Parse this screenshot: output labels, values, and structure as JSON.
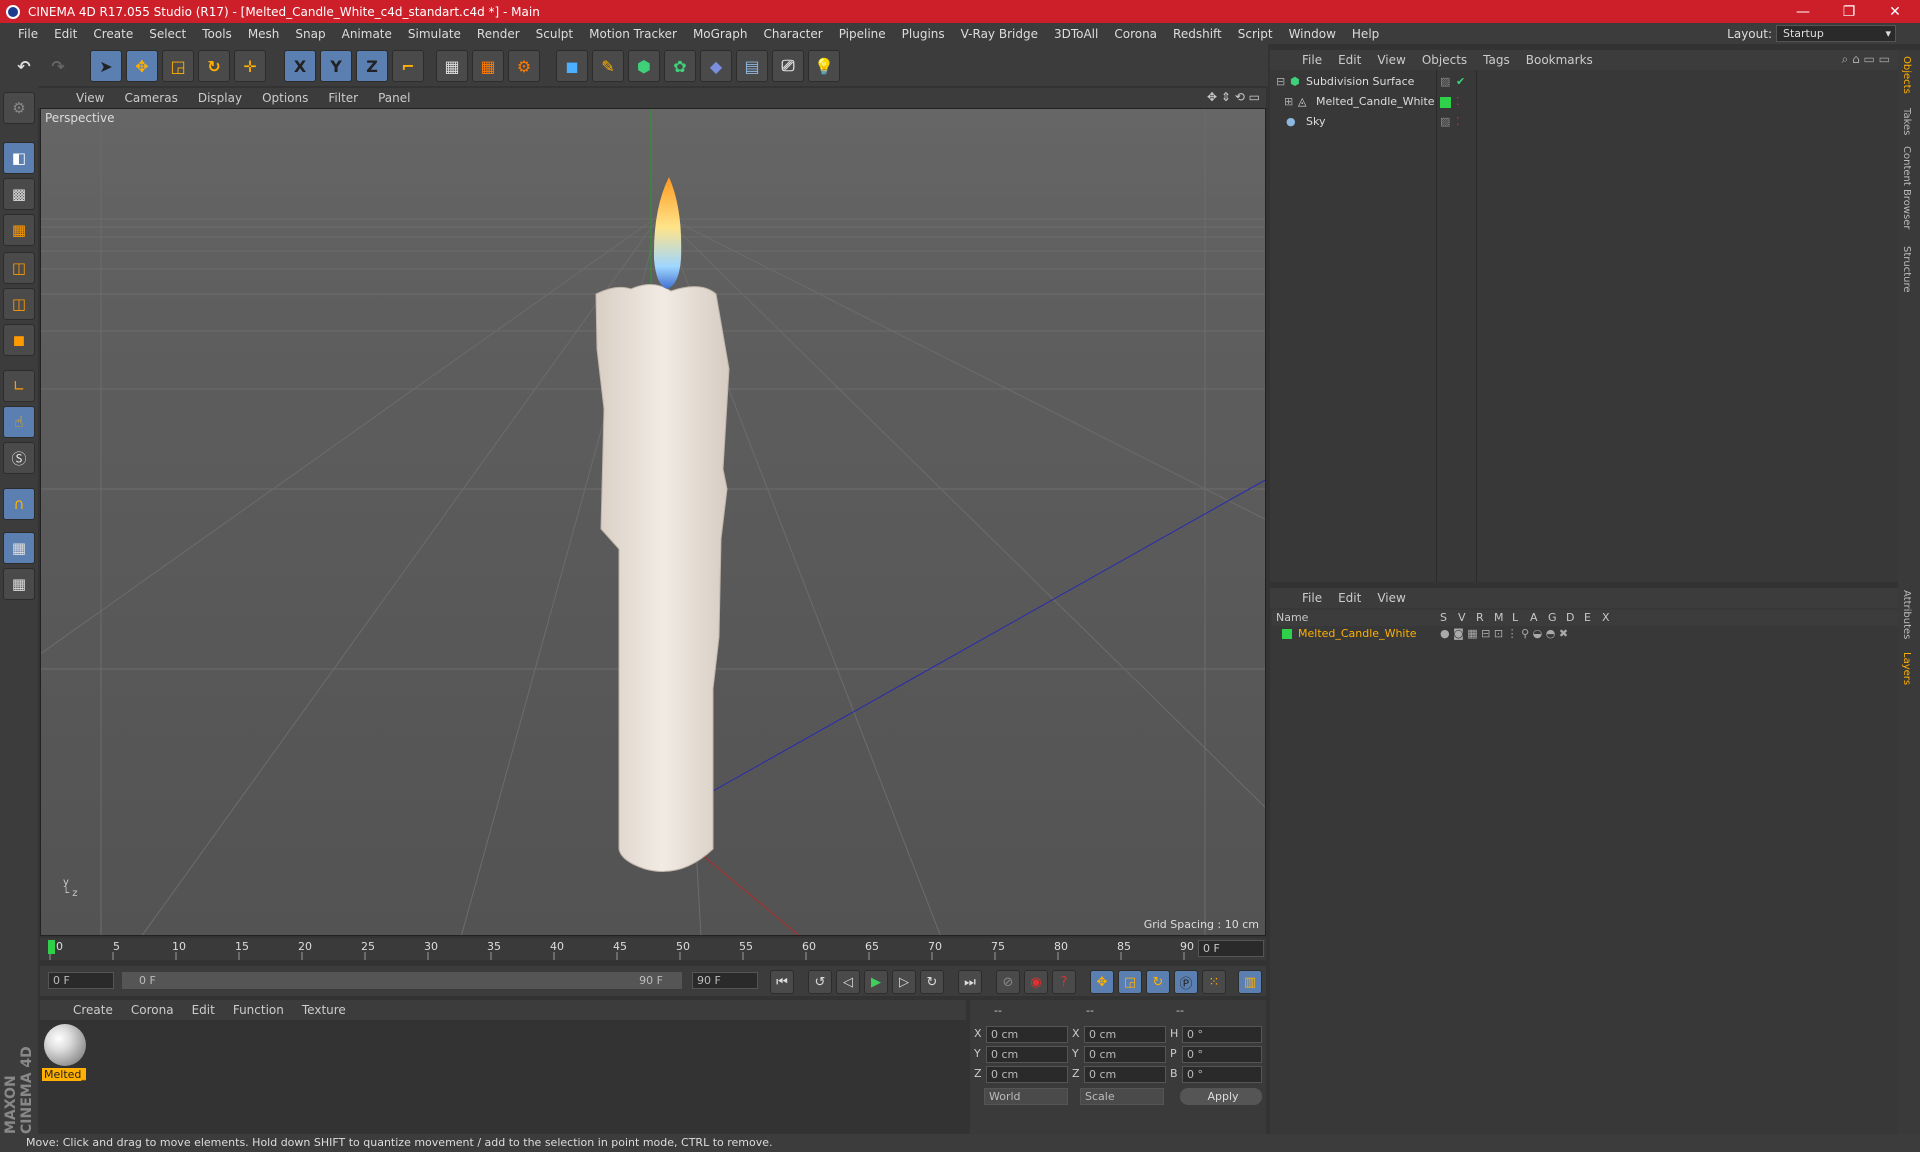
{
  "window": {
    "title": "CINEMA 4D R17.055 Studio (R17) - [Melted_Candle_White_c4d_standart.c4d *] - Main",
    "minimize": "—",
    "restore": "❐",
    "close": "✕"
  },
  "menu": [
    "File",
    "Edit",
    "Create",
    "Select",
    "Tools",
    "Mesh",
    "Snap",
    "Animate",
    "Simulate",
    "Render",
    "Sculpt",
    "Motion Tracker",
    "MoGraph",
    "Character",
    "Pipeline",
    "Plugins",
    "V-Ray Bridge",
    "3DToAll",
    "Corona",
    "Redshift",
    "Script",
    "Window",
    "Help"
  ],
  "layout": {
    "label": "Layout:",
    "value": "Startup"
  },
  "toolbar": {
    "x": "X",
    "y": "Y",
    "z": "Z"
  },
  "viewport": {
    "menu": [
      "View",
      "Cameras",
      "Display",
      "Options",
      "Filter",
      "Panel"
    ],
    "label": "Perspective",
    "grid_spacing": "Grid Spacing : 10 cm"
  },
  "timeline": {
    "ticks": [
      "0",
      "5",
      "10",
      "15",
      "20",
      "25",
      "30",
      "35",
      "40",
      "45",
      "50",
      "55",
      "60",
      "65",
      "70",
      "75",
      "80",
      "85",
      "90"
    ],
    "current_frame": "0 F",
    "start": "0 F",
    "range_start": "0 F",
    "range_end": "90 F",
    "end": "90 F"
  },
  "material_menu": [
    "Create",
    "Corona",
    "Edit",
    "Function",
    "Texture"
  ],
  "material": {
    "name": "Melted_"
  },
  "coords": {
    "hdr": [
      "--",
      "--",
      "--"
    ],
    "rows": [
      {
        "a": "X",
        "av": "0 cm",
        "b": "X",
        "bv": "0 cm",
        "c": "H",
        "cv": "0 °"
      },
      {
        "a": "Y",
        "av": "0 cm",
        "b": "Y",
        "bv": "0 cm",
        "c": "P",
        "cv": "0 °"
      },
      {
        "a": "Z",
        "av": "0 cm",
        "b": "Z",
        "bv": "0 cm",
        "c": "B",
        "cv": "0 °"
      }
    ],
    "world": "World",
    "scale": "Scale",
    "apply": "Apply"
  },
  "status": "Move: Click and drag to move elements. Hold down SHIFT to quantize movement / add to the selection in point mode, CTRL to remove.",
  "objects_menu": [
    "File",
    "Edit",
    "View",
    "Objects",
    "Tags",
    "Bookmarks"
  ],
  "objects": [
    {
      "name": "Subdivision Surface"
    },
    {
      "name": "Melted_Candle_White"
    },
    {
      "name": "Sky"
    }
  ],
  "layers_menu": [
    "File",
    "Edit",
    "View"
  ],
  "layers": {
    "header": {
      "name": "Name",
      "cols": [
        "S",
        "V",
        "R",
        "M",
        "L",
        "A",
        "G",
        "D",
        "E",
        "X"
      ]
    },
    "items": [
      {
        "name": "Melted_Candle_White"
      }
    ]
  },
  "right_tabs": [
    "Objects",
    "Takes",
    "Content Browser",
    "Structure",
    "Attributes",
    "Layers"
  ],
  "maxon": "MAXON CINEMA 4D",
  "colors": {
    "titlebar": "#cc1f2a",
    "accent": "#ffb000",
    "selected": "#5a7fb0"
  }
}
